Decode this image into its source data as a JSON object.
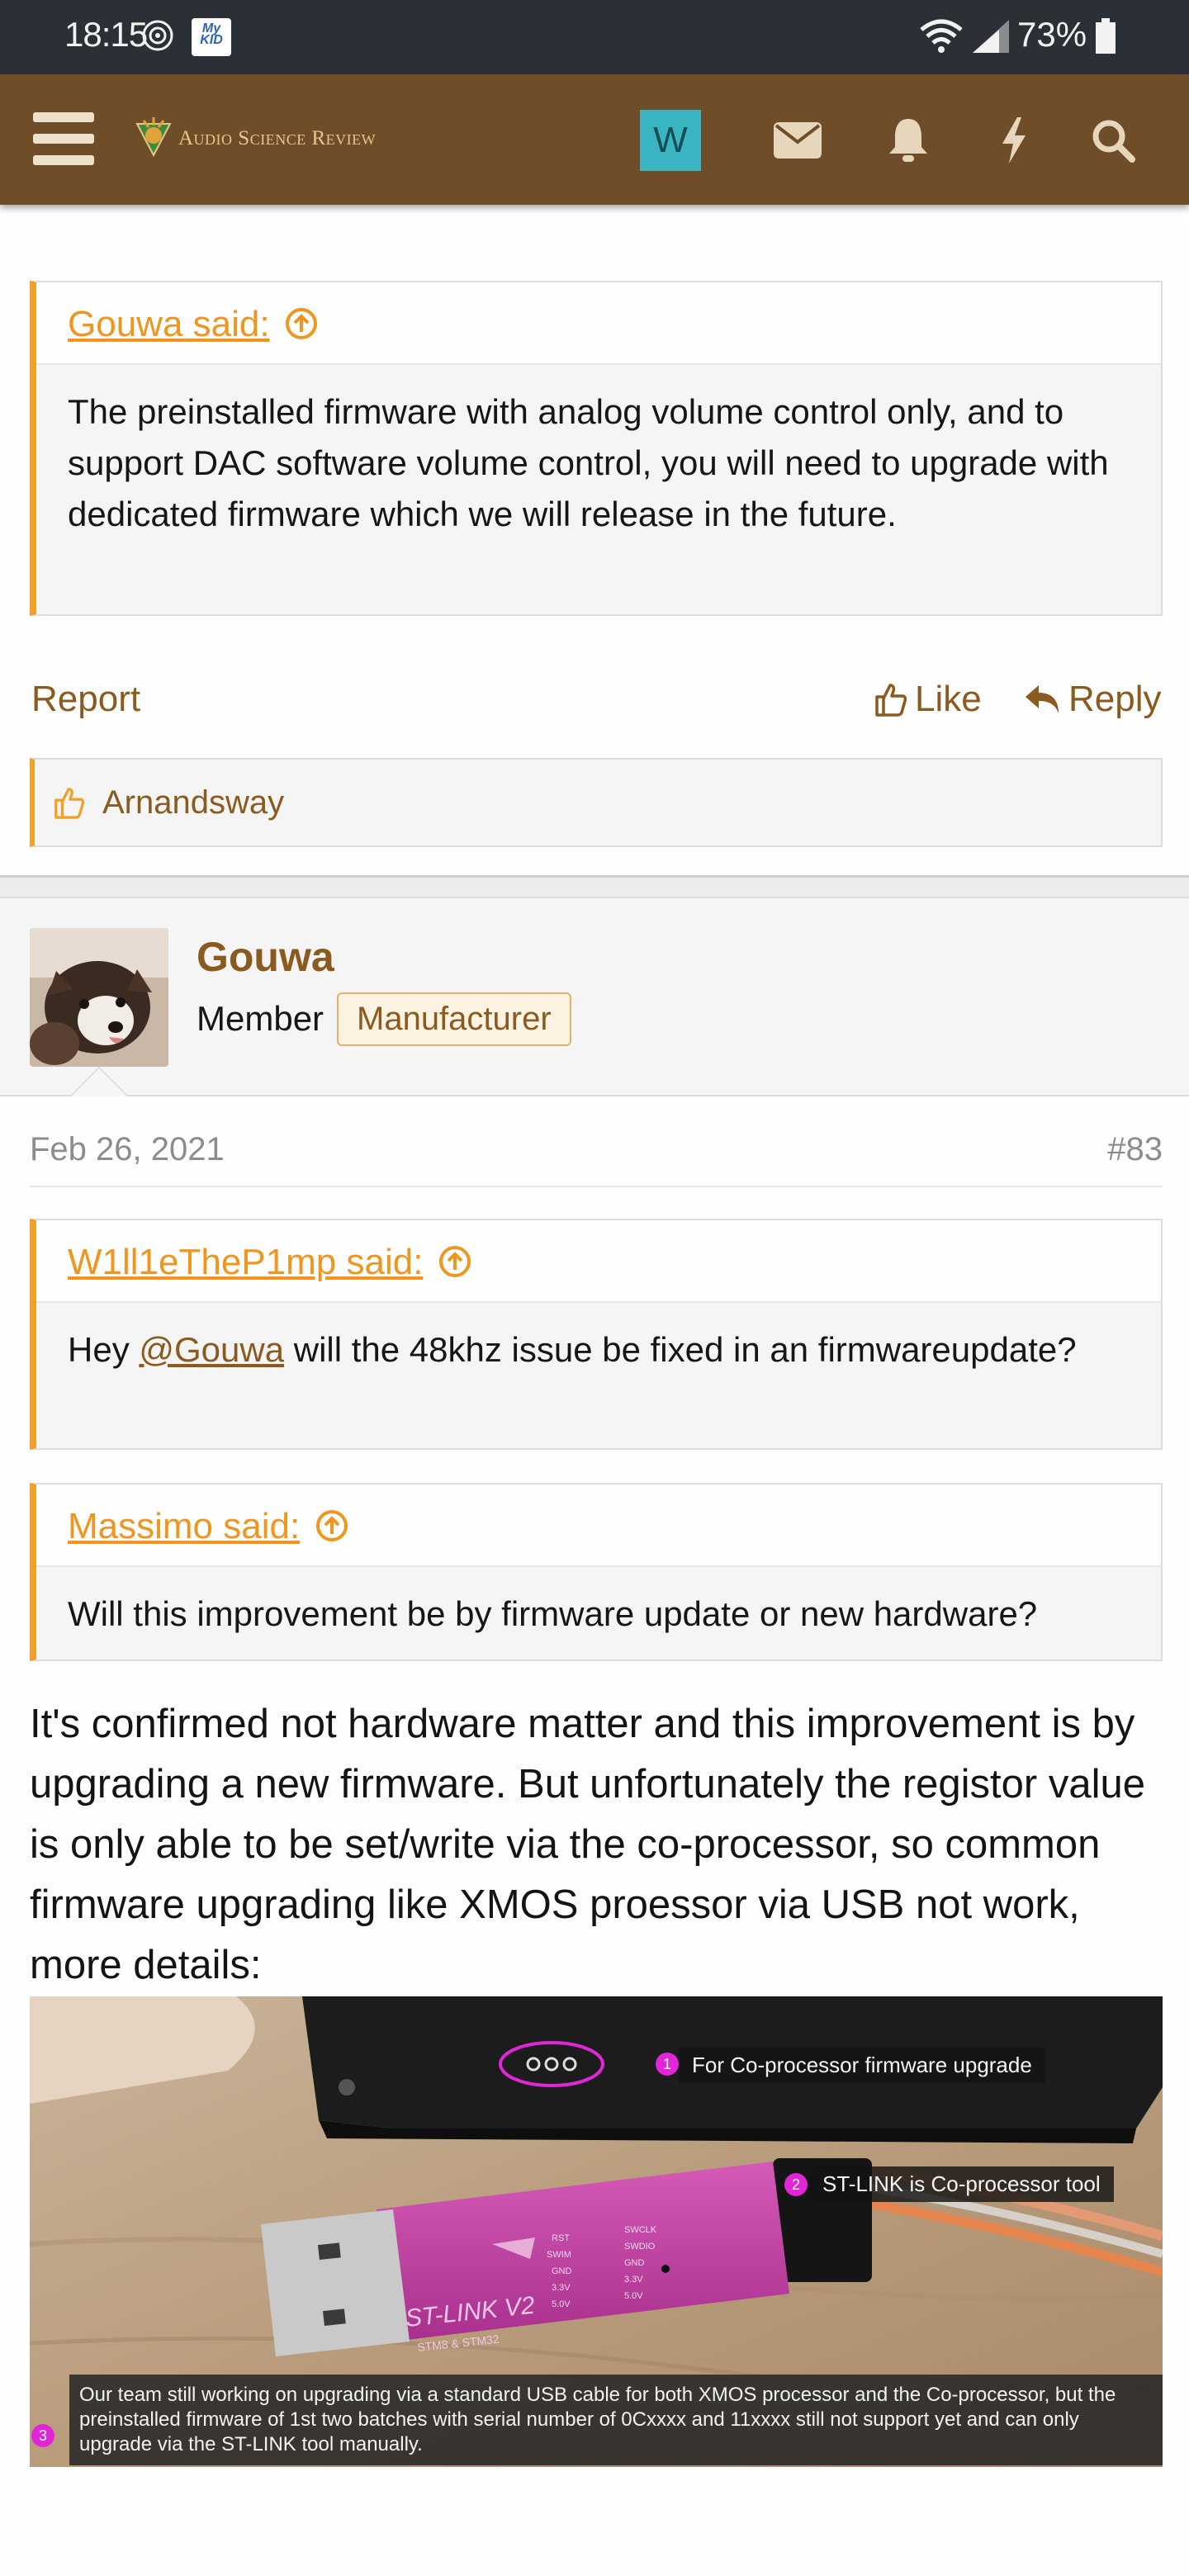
{
  "status_bar": {
    "time": "18:15",
    "kid_badge": "My KID",
    "battery": "73%"
  },
  "header": {
    "logo_text": "Audio Science Review",
    "user_initial": "W",
    "icons": [
      "menu-icon",
      "mail-icon",
      "bell-icon",
      "bolt-icon",
      "search-icon"
    ],
    "accent": "#6f4d28"
  },
  "quote1": {
    "author": "Gouwa said:",
    "body": "The preinstalled firmware with analog volume control only, and to support DAC software volume control, you will need to upgrade with dedicated firmware which we will release in the future."
  },
  "actions": {
    "report": "Report",
    "like": "Like",
    "reply": "Reply"
  },
  "likes": {
    "names": "Arnandsway"
  },
  "post": {
    "username": "Gouwa",
    "user_title": "Member",
    "badge": "Manufacturer",
    "date": "Feb 26, 2021",
    "number": "#83",
    "quote_a": {
      "author": "W1ll1eTheP1mp said:",
      "pre": "Hey ",
      "mention": "@Gouwa",
      "post": " will the 48khz issue be fixed in an firmwareupdate?"
    },
    "quote_b": {
      "author": "Massimo said:",
      "body": "Will this improvement be by firmware update or new hardware?"
    },
    "body": "It's confirmed not hardware matter and this improvement is by upgrading a new firmware. But unfortunately the registor value is only able to be set/write via the co-processor, so common firmware upgrading like XMOS proessor via USB not work, more details:",
    "image": {
      "label1_num": "1",
      "label1": "For Co-processor firmware upgrade",
      "label2_num": "2",
      "label2": "ST-LINK is Co-processor tool",
      "label3_num": "3",
      "caption": "Our team still working on upgrading via a standard USB cable for both XMOS processor and the Co-processor, but the preinstalled firmware of 1st two batches with serial number of 0Cxxxx and 11xxxx still not support yet and can only upgrade via the ST-LINK tool manually.",
      "stlink_label": "ST-LINK V2",
      "stlink_sub": "STM8 & STM32",
      "pins_left": [
        "RST",
        "SWIM",
        "GND",
        "3.3V",
        "5.0V"
      ],
      "pins_right": [
        "SWCLK",
        "SWDIO",
        "GND",
        "3.3V",
        "5.0V"
      ]
    }
  }
}
